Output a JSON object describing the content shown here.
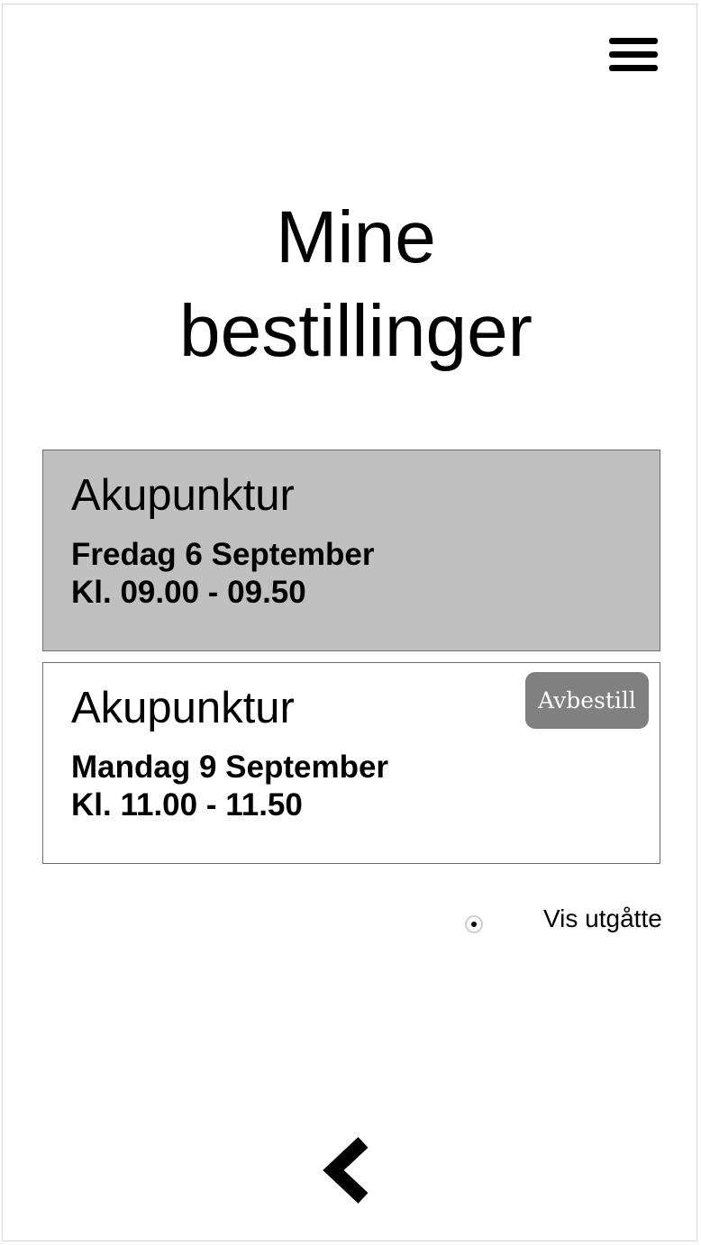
{
  "header": {
    "menu_icon": "hamburger-menu-icon"
  },
  "page": {
    "title_line1": "Mine",
    "title_line2": "bestillinger"
  },
  "orders": [
    {
      "service": "Akupunktur",
      "date": "Fredag 6 September",
      "time": "Kl. 09.00 - 09.50",
      "status": "past"
    },
    {
      "service": "Akupunktur",
      "date": "Mandag 9 September",
      "time": "Kl. 11.00 - 11.50",
      "status": "upcoming",
      "cancel_label": "Avbestill"
    }
  ],
  "filter": {
    "show_expired_label": "Vis utgåtte",
    "show_expired_selected": true
  },
  "footer": {
    "back_icon": "chevron-left-icon"
  },
  "colors": {
    "past_card_bg": "#c0c0c0",
    "cancel_button_bg": "#808080",
    "card_border": "#6d6d6d"
  }
}
